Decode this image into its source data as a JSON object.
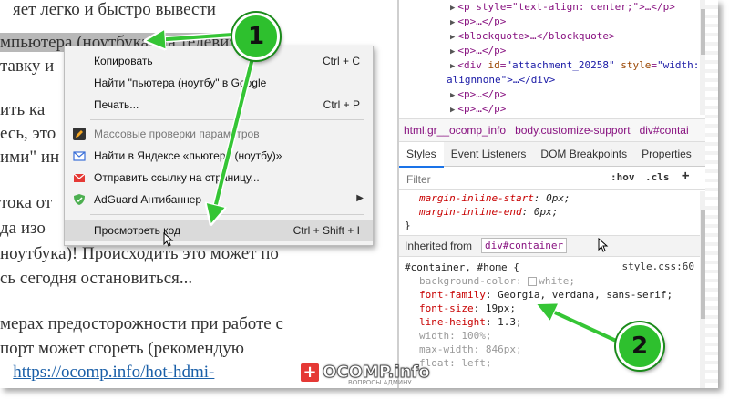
{
  "page": {
    "lines": [
      {
        "pre": "",
        "sel": "",
        "text": "яет легко и быстро вывести",
        "post": ""
      },
      {
        "pre": "",
        "sel": "мпьютера (ноутбука) на телевизор",
        "text": "",
        "post": ""
      },
      {
        "pre": "",
        "sel": "",
        "text": "тавку и",
        "post": ""
      },
      {
        "pre": "",
        "sel": "",
        "text": "ить ка",
        "post": ""
      },
      {
        "pre": "",
        "sel": "",
        "text": "есь, это",
        "post": ""
      },
      {
        "pre": "",
        "sel": "",
        "text": "ими\" ин",
        "post": ""
      },
      {
        "pre": "",
        "sel": "",
        "text": "тока от",
        "post": ""
      },
      {
        "pre": "",
        "sel": "",
        "text": "да изо",
        "post": ""
      },
      {
        "pre": "",
        "sel": "",
        "text": "ноутбука)! Происходить это может по",
        "post": ""
      },
      {
        "pre": "",
        "sel": "",
        "text": "сь сегодня остановиться...",
        "post": ""
      },
      {
        "pre": "",
        "sel": "",
        "text": "мерах предосторожности при работе с",
        "post": ""
      },
      {
        "pre": "",
        "sel": "",
        "text": "порт может сгореть (рекомендую",
        "post": ""
      }
    ],
    "link_dash": "– ",
    "link_text": "https://ocomp.info/hot-hdmi-"
  },
  "menu": {
    "items": [
      {
        "label": "Копировать",
        "shortcut": "Ctrl + C",
        "icon": "none"
      },
      {
        "label": "Найти \"пьютера (ноутбу\" в Google",
        "shortcut": "",
        "icon": "none"
      },
      {
        "label": "Печать...",
        "shortcut": "Ctrl + P",
        "icon": "none"
      },
      {
        "label": "Массовые проверки параметров",
        "shortcut": "",
        "icon": "pencil-icon"
      },
      {
        "label": "Найти в Яндексе «пьютера (ноутбу)»",
        "shortcut": "",
        "icon": "envelope-icon"
      },
      {
        "label": "Отправить ссылку на страницу...",
        "shortcut": "",
        "icon": "mail-send-icon"
      },
      {
        "label": "AdGuard Антибаннер",
        "shortcut": "",
        "icon": "adguard-shield-icon"
      },
      {
        "label": "Просмотреть код",
        "shortcut": "Ctrl + Shift + I",
        "icon": "none"
      }
    ]
  },
  "devtools": {
    "dom": {
      "line0": "<p style=\"text-align: center;\">…</p>",
      "p": "p",
      "blockquote": "blockquote",
      "div_id_attr": "id",
      "div_id_val": "\"attachment_20258\"",
      "div_style_attr": "style",
      "div_style_val": "\"width:",
      "alignnone": "alignnone\">…</div>",
      "ellipsis": ">…</"
    },
    "breadcrumbs": [
      "html.gr__ocomp_info",
      "body.customize-support",
      "div#contai"
    ],
    "tabs": [
      "Styles",
      "Event Listeners",
      "DOM Breakpoints",
      "Properties"
    ],
    "filter_placeholder": "Filter",
    "hov": ":hov",
    "cls": ".cls",
    "plus": "+",
    "rules_top": [
      {
        "name": "margin-inline-start",
        "value": "0px;"
      },
      {
        "name": "margin-inline-end",
        "value": "0px;"
      }
    ],
    "close_brace": "}",
    "inherited_label": "Inherited from",
    "inherited_selector": "div#container",
    "container_selector": "#container, #home {",
    "source_link": "style.css:60",
    "props": [
      {
        "name": "background-color",
        "value": "white;",
        "struck": true,
        "swatch": true
      },
      {
        "name": "font-family",
        "value": "Georgia, verdana, sans-serif;",
        "struck": false,
        "swatch": false
      },
      {
        "name": "font-size",
        "value": "19px;",
        "struck": false,
        "swatch": false
      },
      {
        "name": "line-height",
        "value": "1.3;",
        "struck": false,
        "swatch": false
      },
      {
        "name": "width",
        "value": "100%;",
        "struck": true,
        "swatch": false
      },
      {
        "name": "max-width",
        "value": "846px;",
        "struck": true,
        "swatch": false
      },
      {
        "name": "float",
        "value": "left;",
        "struck": true,
        "swatch": false
      }
    ]
  },
  "annotations": {
    "badge1": "1",
    "badge2": "2",
    "arrow_color": "#35c535"
  },
  "watermark": {
    "symbol": "+",
    "text": "OCOMP.info",
    "sub": "ВОПРОСЫ АДМИНУ"
  }
}
